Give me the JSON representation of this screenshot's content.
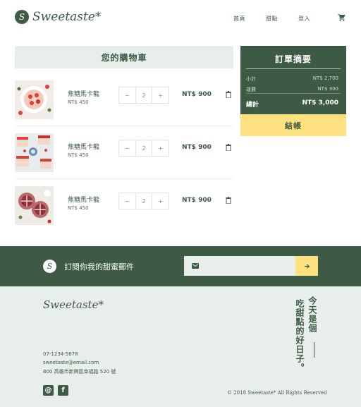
{
  "brand": {
    "name": "Sweetaste*",
    "mark": "S"
  },
  "nav": {
    "home": "首頁",
    "desserts": "甜點",
    "login": "登入"
  },
  "cart": {
    "title": "您的購物車",
    "items": [
      {
        "name": "焦糖馬卡龍",
        "unit_price": "NT$ 450",
        "qty": "2",
        "total": "NT$ 900"
      },
      {
        "name": "焦糖馬卡龍",
        "unit_price": "NT$ 450",
        "qty": "2",
        "total": "NT$ 900"
      },
      {
        "name": "焦糖馬卡龍",
        "unit_price": "NT$ 450",
        "qty": "2",
        "total": "NT$ 900"
      }
    ],
    "minus": "−",
    "plus": "+"
  },
  "summary": {
    "title": "訂單摘要",
    "subtotal_label": "小計",
    "subtotal": "NT$ 2,700",
    "shipping_label": "運費",
    "shipping": "NT$ 300",
    "total_label": "總計",
    "total": "NT$ 3,000",
    "checkout": "結帳"
  },
  "subscribe": {
    "text": "訂閱你我的甜蜜郵件",
    "placeholder": ""
  },
  "footer": {
    "logo": "Sweetaste*",
    "phone": "07-1234-5678",
    "email": "sweetaste@email.com",
    "address": "800 高雄市新興區幸福路 520 號",
    "copyright": "© 2018 Sweetaste* All Rights Reserved",
    "slogan_col1": "今天是個",
    "slogan_col2": "吃甜點的好日子。",
    "social": [
      "instagram-icon",
      "facebook-icon"
    ]
  },
  "colors": {
    "primary": "#3d5a45",
    "accent": "#ffe180",
    "light": "#e8eeeb"
  }
}
